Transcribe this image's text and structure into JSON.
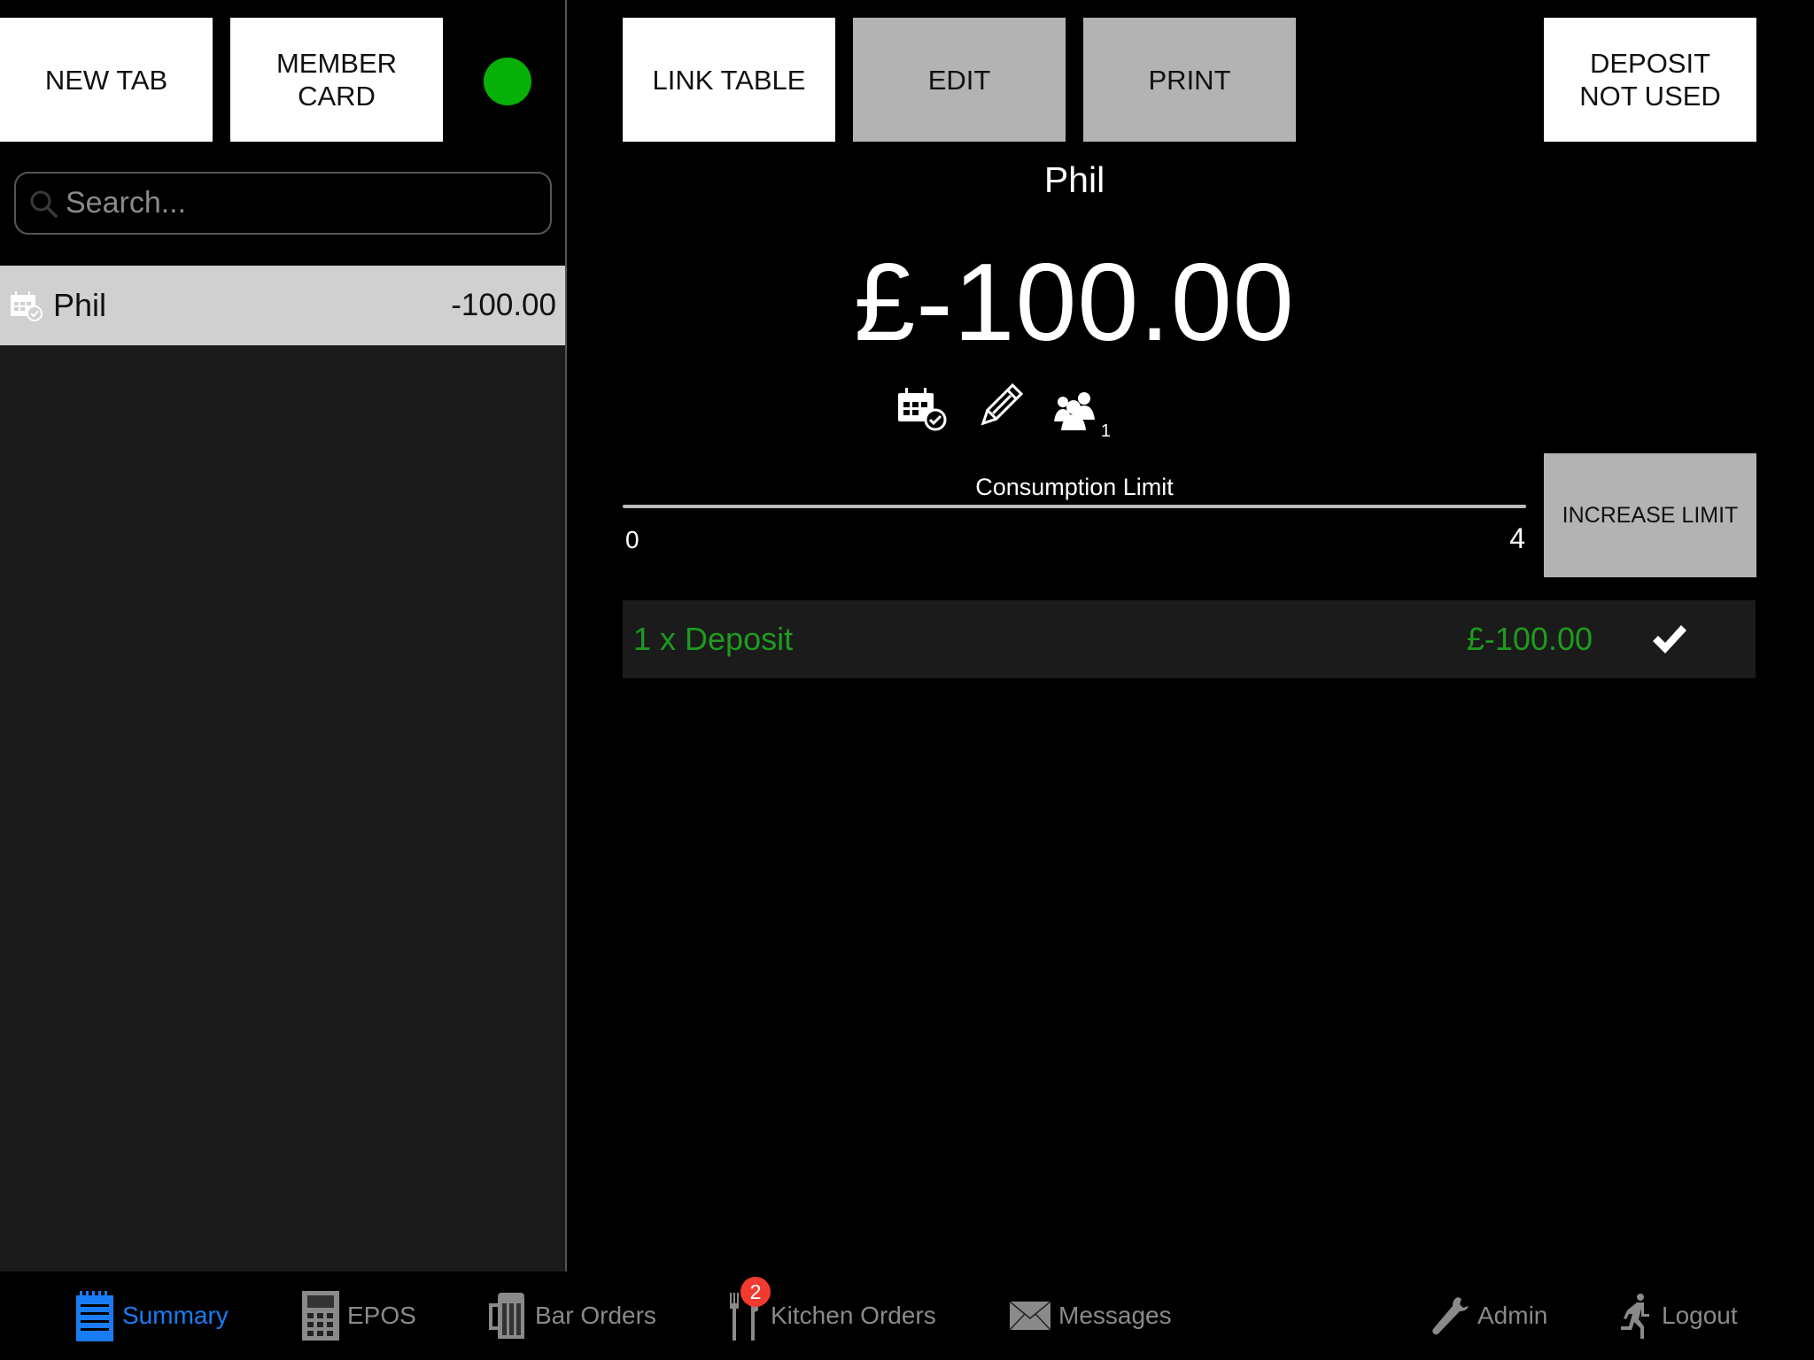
{
  "colors": {
    "status_online": "#07b007",
    "active_tab": "#1a7cf5",
    "inactive_tab": "#8a8a8a",
    "deposit_text": "#1f9a1f",
    "badge": "#f23a30"
  },
  "sidebar": {
    "new_tab_label": "NEW TAB",
    "member_card_label": "MEMBER\nCARD",
    "status": "online",
    "search": {
      "placeholder": "Search...",
      "value": ""
    },
    "tabs": [
      {
        "name": "Phil",
        "amount": "-100.00",
        "icon": "calendar-check-icon",
        "selected": true
      }
    ]
  },
  "toolbar": {
    "link_table_label": "LINK TABLE",
    "edit_label": "EDIT",
    "print_label": "PRINT",
    "deposit_label": "DEPOSIT\nNOT USED"
  },
  "tab_detail": {
    "customer_name": "Phil",
    "balance": "£-100.00",
    "icons": [
      "calendar-check-icon",
      "pencil-icon",
      "guests-icon"
    ],
    "guest_count": "1",
    "consumption": {
      "label": "Consumption Limit",
      "min_label": "0",
      "max_label": "4",
      "value": 0,
      "max": 4,
      "increase_label": "INCREASE LIMIT"
    },
    "items": [
      {
        "description": "1 x Deposit",
        "price": "£-100.00",
        "confirmed": true
      }
    ]
  },
  "tabbar": {
    "items": [
      {
        "label": "Summary",
        "icon": "notepad-icon",
        "active": true
      },
      {
        "label": "EPOS",
        "icon": "calculator-icon",
        "active": false
      },
      {
        "label": "Bar Orders",
        "icon": "beer-mug-icon",
        "active": false
      },
      {
        "label": "Kitchen Orders",
        "icon": "fork-knife-icon",
        "active": false,
        "badge": "2"
      },
      {
        "label": "Messages",
        "icon": "envelope-icon",
        "active": false
      },
      {
        "label": "Admin",
        "icon": "wrench-icon",
        "active": false
      },
      {
        "label": "Logout",
        "icon": "running-man-icon",
        "active": false
      }
    ]
  }
}
